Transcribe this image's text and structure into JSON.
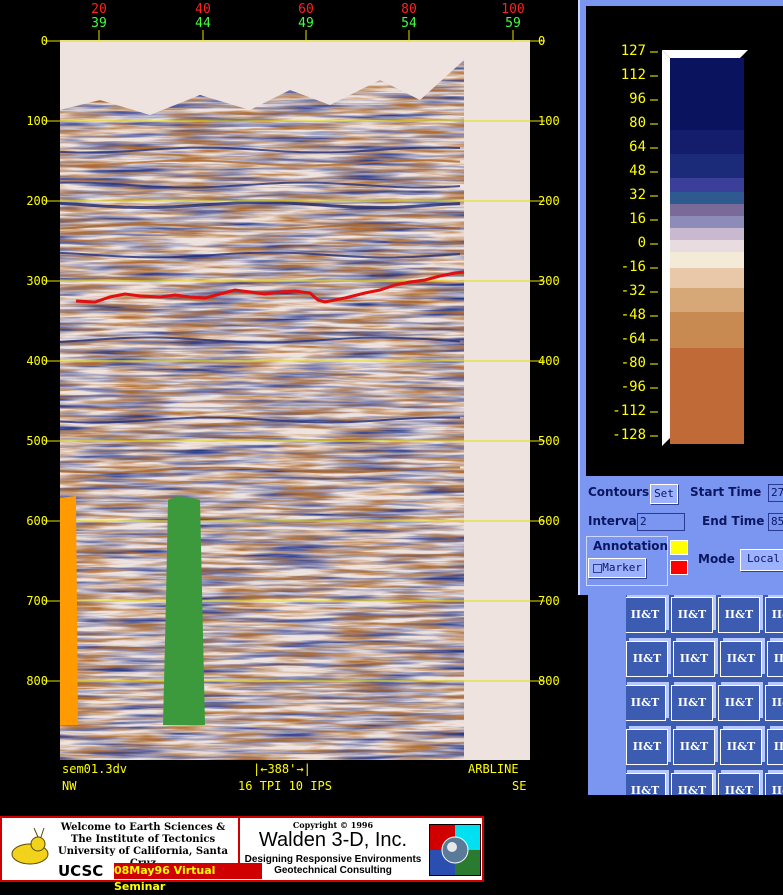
{
  "seismic": {
    "top_axis_red": [
      "20",
      "40",
      "60",
      "80",
      "100"
    ],
    "top_axis_green": [
      "39",
      "44",
      "49",
      "54",
      "59"
    ],
    "time_ticks": [
      "0",
      "100",
      "200",
      "300",
      "400",
      "500",
      "600",
      "700",
      "800"
    ],
    "footer_left_1": "sem01.3dv",
    "footer_left_2": "NW",
    "footer_scale": "388'",
    "footer_scale_text": "16 TPI 10 IPS",
    "footer_right_1": "ARBLINE",
    "footer_right_2": "SE",
    "colors": {
      "horizon": "#e01010",
      "well_left": "#ff9a00",
      "well_mid": "#3c9a3c",
      "gridline": "#e6e000"
    }
  },
  "colorbar": {
    "labels": [
      "127",
      "112",
      "96",
      "80",
      "64",
      "48",
      "32",
      "16",
      "0",
      "-16",
      "-32",
      "-48",
      "-64",
      "-80",
      "-96",
      "-112",
      "-128"
    ]
  },
  "controls": {
    "contours_label": "Contours:",
    "set_button": "Set",
    "start_time_label": "Start Time",
    "start_time_value": "27",
    "interval_label": "Interval",
    "interval_value": "2",
    "end_time_label": "End Time",
    "end_time_value": "85",
    "annotation_label": "Annotation",
    "marker_button": "Marker",
    "mode_label": "Mode",
    "local_button": "Local"
  },
  "banner": {
    "welcome_1": "Welcome to Earth Sciences &",
    "welcome_2": "The Institute of Tectonics",
    "welcome_3": "University of California, Santa Cruz",
    "ucsc": "UCSC",
    "seminar": "08May96 Virtual Seminar",
    "copyright": "Copyright © 1996",
    "company": "Walden 3-D, Inc.",
    "tagline_1": "Designing Responsive Environments",
    "tagline_2": "Geotechnical Consulting"
  },
  "logo_tile": {
    "text": "II&T"
  }
}
